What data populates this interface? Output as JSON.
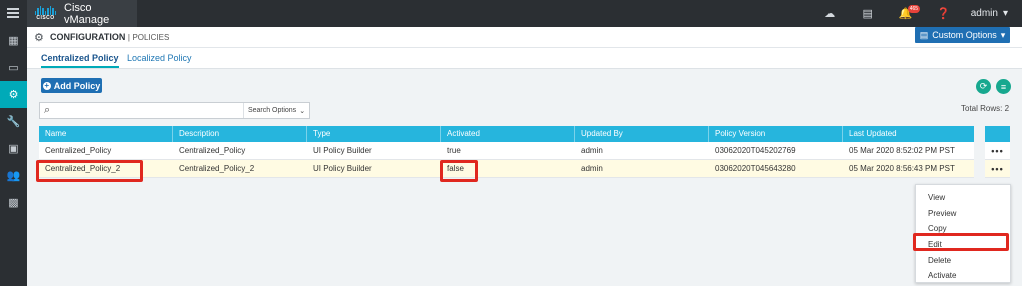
{
  "app": {
    "title": "Cisco vManage",
    "logo_text": "CISCO"
  },
  "topbar": {
    "notification_count": "465",
    "user": "admin"
  },
  "header": {
    "title": "CONFIGURATION",
    "separator": "|",
    "subtitle": "POLICIES",
    "custom_options_label": "Custom Options"
  },
  "tabs": [
    {
      "label": "Centralized Policy",
      "active": true
    },
    {
      "label": "Localized Policy",
      "active": false
    }
  ],
  "toolbar": {
    "add_label": "Add Policy",
    "search_placeholder": "",
    "search_options_label": "Search Options",
    "total_rows": "Total Rows: 2"
  },
  "table": {
    "columns": [
      "Name",
      "Description",
      "Type",
      "Activated",
      "Updated By",
      "Policy Version",
      "Last Updated"
    ],
    "rows": [
      [
        "Centralized_Policy",
        "Centralized_Policy",
        "UI Policy Builder",
        "true",
        "admin",
        "03062020T045202769",
        "05 Mar 2020 8:52:02 PM PST"
      ],
      [
        "Centralized_Policy_2",
        "Centralized_Policy_2",
        "UI Policy Builder",
        "false",
        "admin",
        "03062020T045643280",
        "05 Mar 2020 8:56:43 PM PST"
      ]
    ],
    "row_action": "•••"
  },
  "menu": {
    "items": [
      "View",
      "Preview",
      "Copy",
      "Edit",
      "Delete",
      "Activate"
    ]
  },
  "colors": {
    "accent": "#00aab8",
    "primary": "#1f6fb3",
    "table_header": "#26b5dd",
    "highlight": "#e0281f"
  }
}
